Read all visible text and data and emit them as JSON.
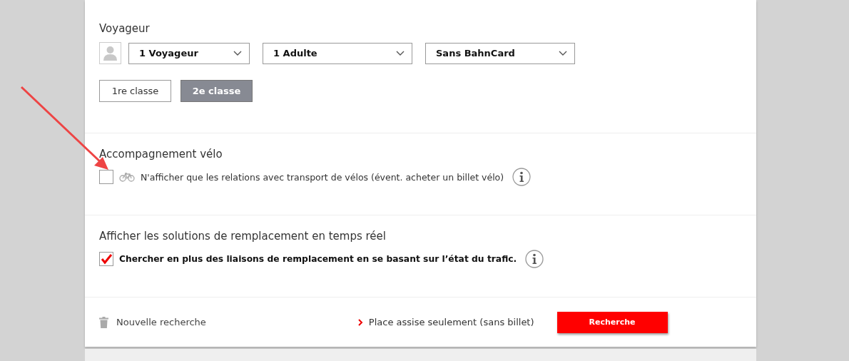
{
  "travellers": {
    "heading": "Voyageur",
    "selects": [
      {
        "value": "1 Voyageur"
      },
      {
        "value": "1 Adulte"
      },
      {
        "value": "Sans BahnCard"
      }
    ],
    "classes": [
      {
        "label": "1re classe",
        "selected": false
      },
      {
        "label": "2e classe",
        "selected": true
      }
    ]
  },
  "bike": {
    "heading": "Accompagnement vélo",
    "label": "N'afficher que les relations avec transport de vélos (évent. acheter un billet vélo)",
    "checked": false
  },
  "realtime": {
    "heading": "Afficher les solutions de remplacement en temps réel",
    "label": "Chercher en plus des liaisons de remplacement en se basant sur l’état du trafic.",
    "checked": true
  },
  "footer": {
    "reset": "Nouvelle recherche",
    "seat_link": "Place assise seulement (sans billet)",
    "search_button": "Recherche"
  }
}
